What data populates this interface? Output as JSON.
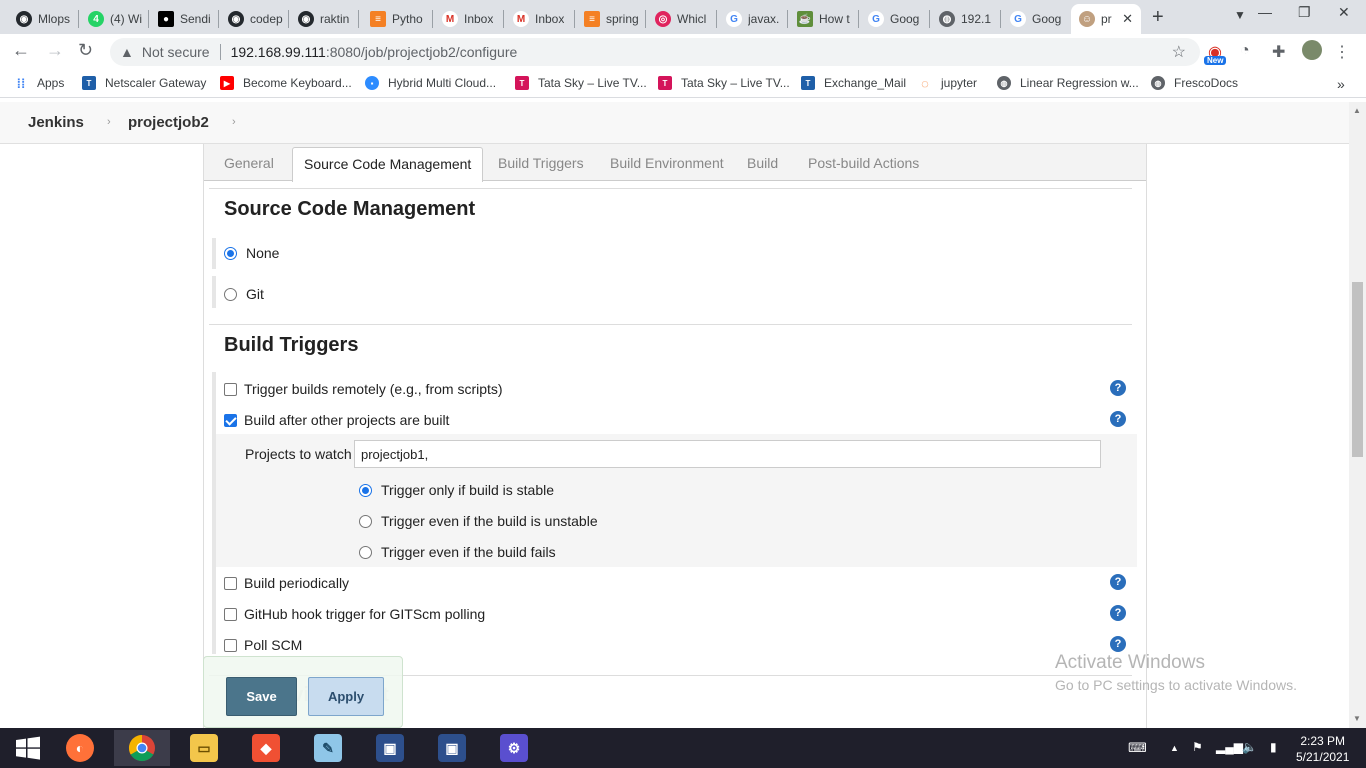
{
  "browser": {
    "tabs": [
      {
        "label": "Mlops",
        "icon": "github-icon",
        "color": "#24292e"
      },
      {
        "label": "(4) Wi",
        "icon": "whatsapp-icon",
        "color": "#25d366"
      },
      {
        "label": "Sendi",
        "icon": "medium-icon",
        "color": "#000000"
      },
      {
        "label": "codep",
        "icon": "github-icon",
        "color": "#24292e"
      },
      {
        "label": "raktin",
        "icon": "github-icon",
        "color": "#24292e"
      },
      {
        "label": "Pytho",
        "icon": "stackoverflow-icon",
        "color": "#f48024"
      },
      {
        "label": "Inbox",
        "icon": "gmail-icon",
        "color": "#d93025"
      },
      {
        "label": "Inbox",
        "icon": "gmail-icon",
        "color": "#d93025"
      },
      {
        "label": "spring",
        "icon": "stackoverflow-icon",
        "color": "#f48024"
      },
      {
        "label": "Whicl",
        "icon": "target-icon",
        "color": "#e0245e"
      },
      {
        "label": "javax.",
        "icon": "google-icon",
        "color": "#4285f4"
      },
      {
        "label": "How t",
        "icon": "java-icon",
        "color": "#5f8e3b"
      },
      {
        "label": "Goog",
        "icon": "google-icon",
        "color": "#4285f4"
      },
      {
        "label": "192.1",
        "icon": "globe-icon",
        "color": "#5f6368"
      },
      {
        "label": "Goog",
        "icon": "google-icon",
        "color": "#4285f4"
      },
      {
        "label": "pr",
        "icon": "jenkins-icon",
        "color": "#c0a080",
        "active": true
      }
    ],
    "url_security": "Not secure",
    "url_host": "192.168.99.111",
    "url_path": ":8080/job/projectjob2/configure",
    "new_badge": "New",
    "bookmarks": [
      {
        "label": "Apps",
        "icon": "apps-grid-icon",
        "color": "#4285f4"
      },
      {
        "label": "Netscaler Gateway",
        "icon": "tata-icon",
        "color": "#1f5fa8"
      },
      {
        "label": "Become Keyboard...",
        "icon": "youtube-icon",
        "color": "#ff0000"
      },
      {
        "label": "Hybrid Multi Cloud...",
        "icon": "zoom-icon",
        "color": "#2d8cff"
      },
      {
        "label": "Tata Sky – Live TV...",
        "icon": "tatasky-icon",
        "color": "#d4145a"
      },
      {
        "label": "Tata Sky – Live TV...",
        "icon": "tatasky-icon",
        "color": "#d4145a"
      },
      {
        "label": "Exchange_Mail",
        "icon": "tata-icon",
        "color": "#1f5fa8"
      },
      {
        "label": "jupyter",
        "icon": "jupyter-icon",
        "color": "#f37626"
      },
      {
        "label": "Linear Regression w...",
        "icon": "globe-icon",
        "color": "#5f6368"
      },
      {
        "label": "FrescoDocs",
        "icon": "globe-icon",
        "color": "#5f6368"
      }
    ]
  },
  "jenkins": {
    "home": "Jenkins",
    "job": "projectjob2"
  },
  "config_tabs": [
    {
      "label": "General",
      "active": false
    },
    {
      "label": "Source Code Management",
      "active": true
    },
    {
      "label": "Build Triggers",
      "active": false
    },
    {
      "label": "Build Environment",
      "active": false
    },
    {
      "label": "Build",
      "active": false
    },
    {
      "label": "Post-build Actions",
      "active": false
    }
  ],
  "scm": {
    "title": "Source Code Management",
    "options": [
      {
        "label": "None",
        "selected": true
      },
      {
        "label": "Git",
        "selected": false
      }
    ]
  },
  "triggers": {
    "title": "Build Triggers",
    "remote": {
      "label": "Trigger builds remotely (e.g., from scripts)",
      "checked": false
    },
    "after_other": {
      "label": "Build after other projects are built",
      "checked": true
    },
    "projects_label": "Projects to watch",
    "projects_value": "projectjob1,",
    "conditions": [
      {
        "label": "Trigger only if build is stable",
        "selected": true
      },
      {
        "label": "Trigger even if the build is unstable",
        "selected": false
      },
      {
        "label": "Trigger even if the build fails",
        "selected": false
      }
    ],
    "periodic": {
      "label": "Build periodically",
      "checked": false
    },
    "github_hook": {
      "label": "GitHub hook trigger for GITScm polling",
      "checked": false
    },
    "poll_scm": {
      "label": "Poll SCM",
      "checked": false
    }
  },
  "help_glyph": "?",
  "buttons": {
    "save": "Save",
    "apply": "Apply"
  },
  "obscured_title": "nvironment",
  "watermark": {
    "line1": "Activate Windows",
    "line2": "Go to PC settings to activate Windows."
  },
  "taskbar": {
    "time": "2:23 PM",
    "date": "5/21/2021"
  },
  "colors": {
    "accent": "#1a73e8",
    "save_button": "#4b758b",
    "apply_button": "#c8dcef",
    "help": "#2a6ebb"
  }
}
